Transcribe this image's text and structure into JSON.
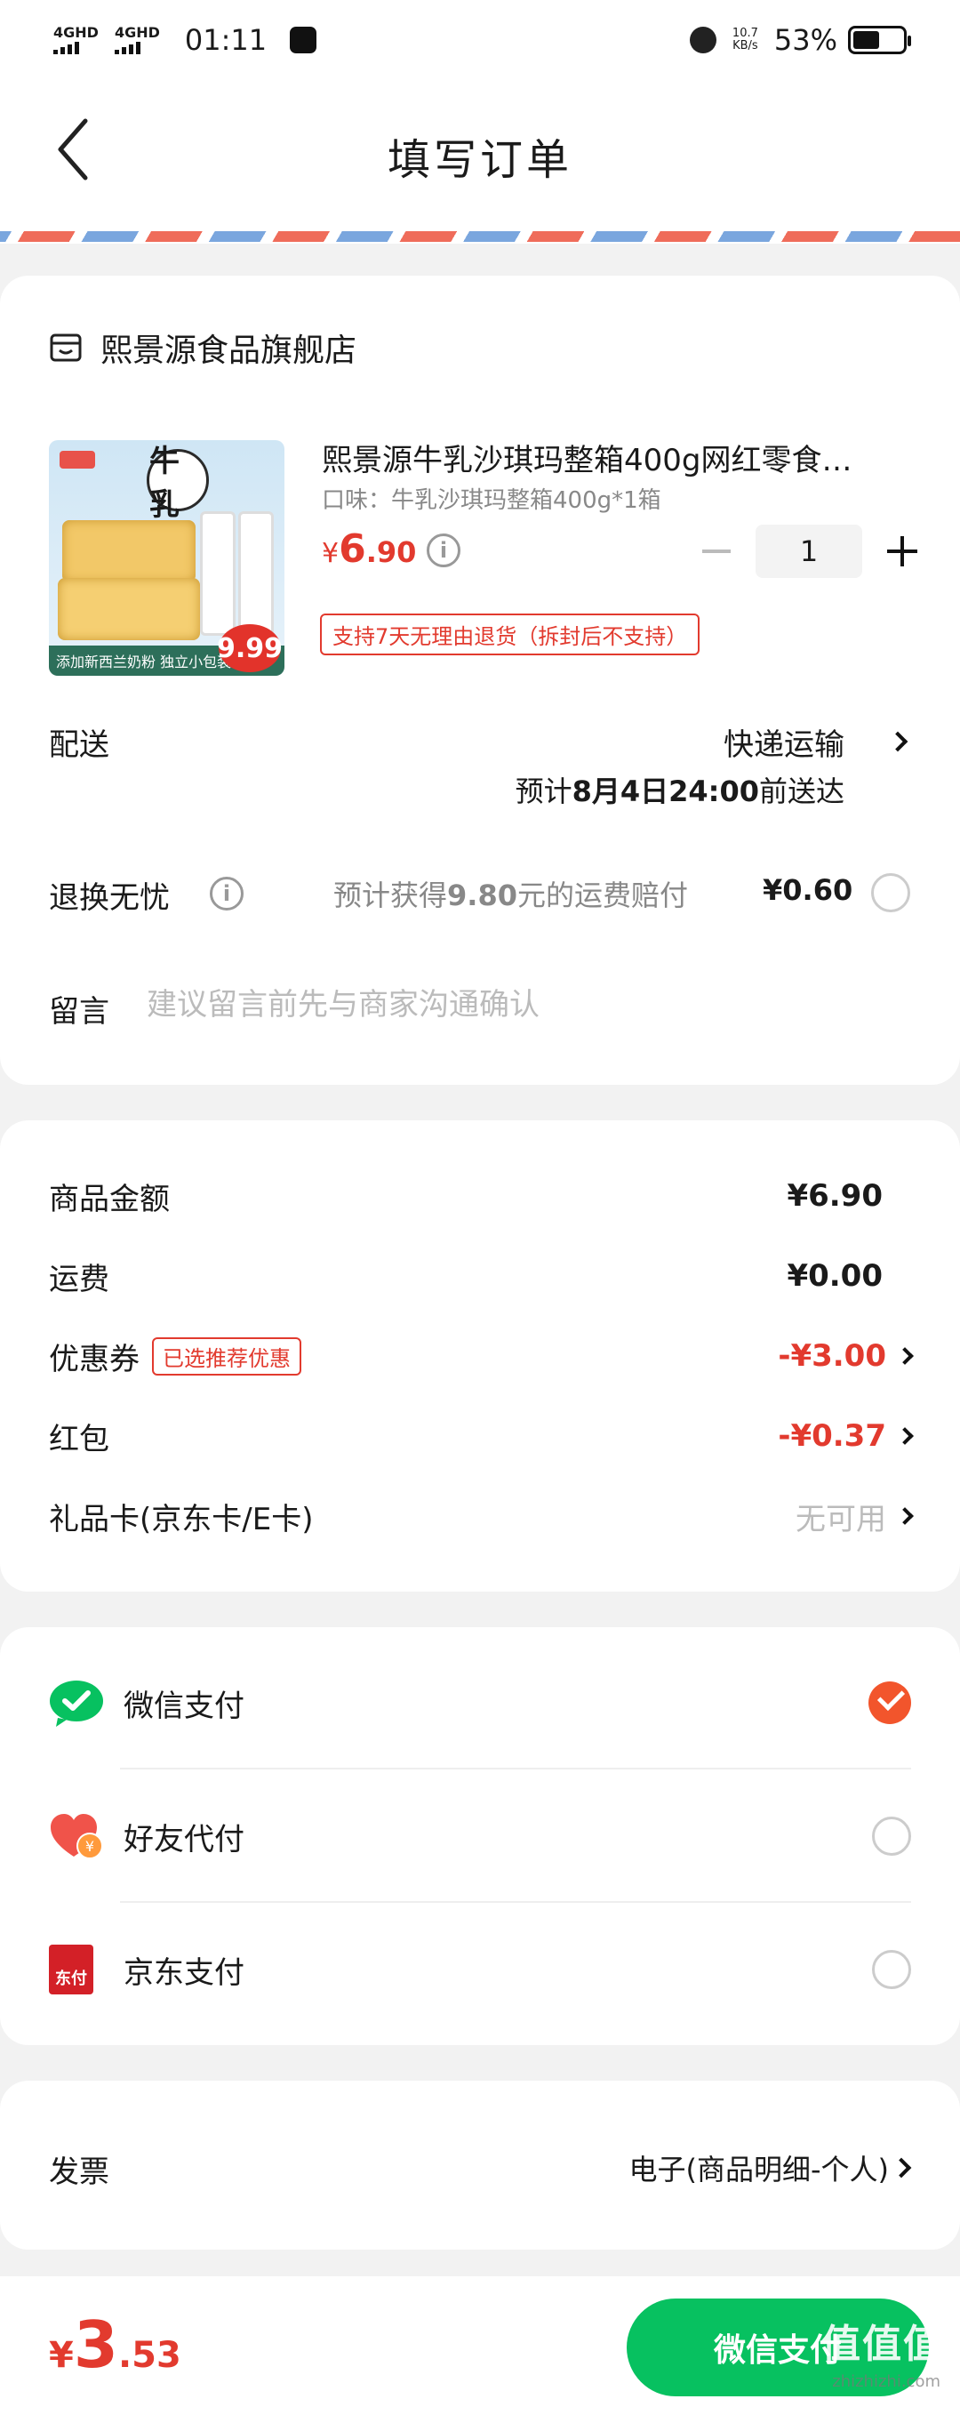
{
  "status_bar": {
    "network1": "4GHD",
    "network2": "4GHD",
    "time": "01:11",
    "speed_value": "10.7",
    "speed_unit": "KB/s",
    "battery": "53%"
  },
  "header": {
    "title": "填写订单"
  },
  "shop": {
    "name": "熙景源食品旗舰店"
  },
  "product": {
    "image_text": {
      "logo": "牛乳",
      "banner": "添加新西兰奶粉 独立小包装",
      "price_badge": "9.99"
    },
    "name": "熙景源牛乳沙琪玛整箱400g网红零食…",
    "spec": "口味：牛乳沙琪玛整箱400g*1箱",
    "price_currency": "¥",
    "price_int": "6",
    "price_dec": ".90",
    "quantity": "1",
    "return_tag": "支持7天无理由退货（拆封后不支持）"
  },
  "delivery": {
    "label": "配送",
    "method": "快递运输",
    "eta_prefix": "预计",
    "eta_date": "8月4日24:00",
    "eta_suffix": "前送达"
  },
  "refund": {
    "label": "退换无忧",
    "desc_prefix": "预计获得",
    "desc_amount": "9.80",
    "desc_suffix": "元的运费赔付",
    "price": "¥0.60"
  },
  "note": {
    "label": "留言",
    "placeholder": "建议留言前先与商家沟通确认"
  },
  "summary": {
    "goods_label": "商品金额",
    "goods_value": "¥6.90",
    "shipping_label": "运费",
    "shipping_value": "¥0.00",
    "coupon_label": "优惠券",
    "coupon_tag": "已选推荐优惠",
    "coupon_value": "-¥3.00",
    "redpacket_label": "红包",
    "redpacket_value": "-¥0.37",
    "giftcard_label": "礼品卡(京东卡/E卡)",
    "giftcard_value": "无可用"
  },
  "payment": {
    "wechat": "微信支付",
    "friend": "好友代付",
    "friend_icon_text": "¥",
    "jd": "京东支付",
    "jd_icon_text": "东付",
    "selected": "wechat"
  },
  "invoice": {
    "label": "发票",
    "value": "电子(商品明细-个人)"
  },
  "bottom": {
    "total_currency": "¥",
    "total_int": "3",
    "total_dec": ".53",
    "pay_button": "微信支付",
    "watermark": "值值值",
    "watermark_sub": "zhizhizhi.com"
  },
  "colors": {
    "accent_red": "#e23a2e",
    "wechat_green": "#07c160",
    "radio_selected": "#f2552c"
  }
}
